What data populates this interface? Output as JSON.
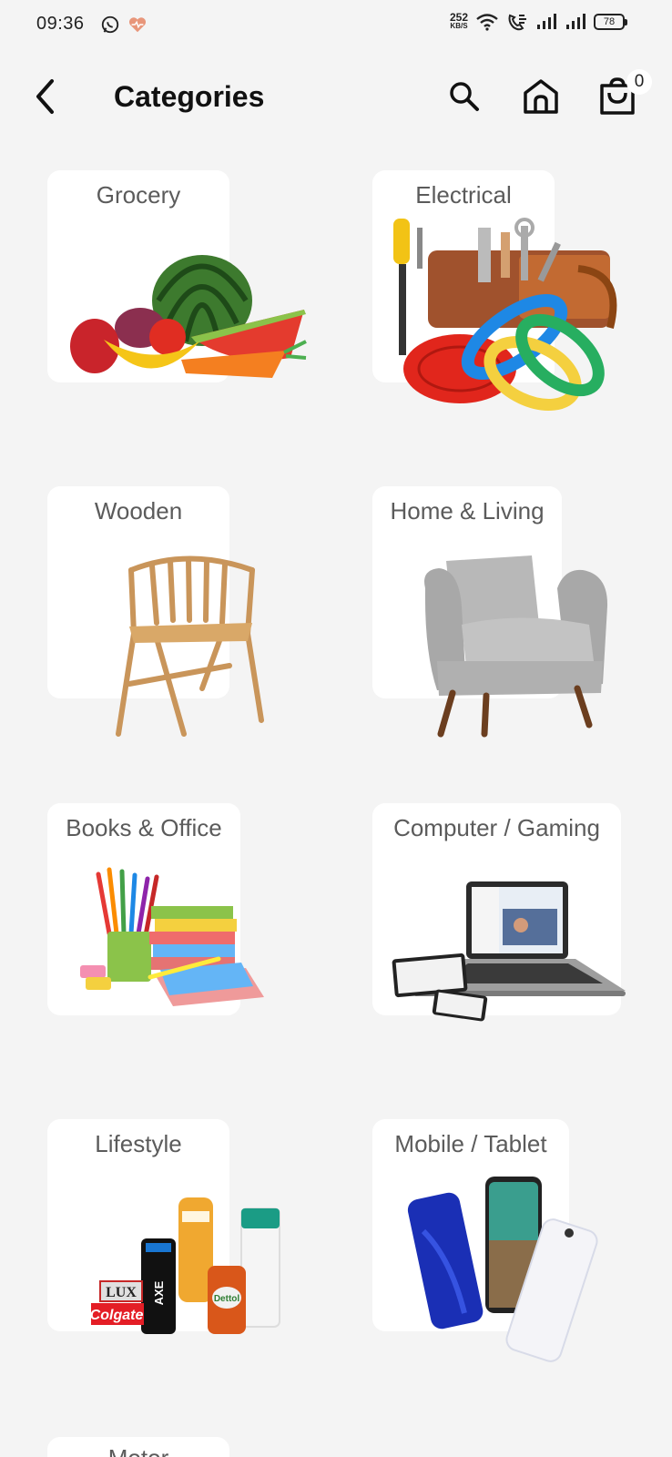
{
  "status_bar": {
    "time": "09:36",
    "net_speed_value": "252",
    "net_speed_unit": "KB/S",
    "battery": "78"
  },
  "header": {
    "title": "Categories",
    "cart_count": "0"
  },
  "categories": [
    {
      "label": "Grocery"
    },
    {
      "label": "Electrical"
    },
    {
      "label": "Wooden"
    },
    {
      "label": "Home & Living"
    },
    {
      "label": "Books & Office"
    },
    {
      "label": "Computer / Gaming"
    },
    {
      "label": "Lifestyle"
    },
    {
      "label": "Mobile / Tablet"
    },
    {
      "label": "Motor"
    }
  ],
  "product_text": {
    "lux": "LUX",
    "colgate": "Colgate",
    "axe": "AXE",
    "dettol": "Dettol"
  },
  "colors": {
    "background": "#f4f4f4",
    "card": "#ffffff",
    "label": "#5b5b5b"
  }
}
